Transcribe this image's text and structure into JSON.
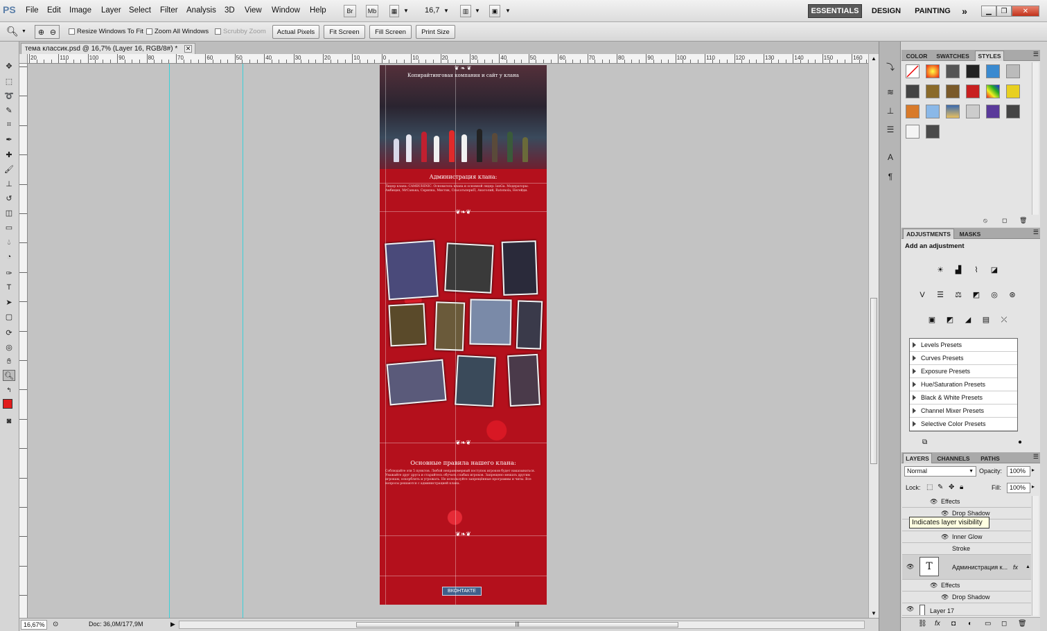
{
  "app": {
    "logo": "PS"
  },
  "menubar": {
    "items": [
      "File",
      "Edit",
      "Image",
      "Layer",
      "Select",
      "Filter",
      "Analysis",
      "3D",
      "View",
      "Window",
      "Help"
    ],
    "bridge_label": "Br",
    "minibridge_label": "Mb",
    "zoom_value": "16,7",
    "workspaces": {
      "essentials": "ESSENTIALS",
      "design": "DESIGN",
      "painting": "PAINTING",
      "more": "»"
    }
  },
  "options": {
    "resize_windows": "Resize Windows To Fit",
    "zoom_all": "Zoom All Windows",
    "scrubby": "Scrubby Zoom",
    "actual_pixels": "Actual Pixels",
    "fit_screen": "Fit Screen",
    "fill_screen": "Fill Screen",
    "print_size": "Print Size"
  },
  "document": {
    "tab_title": "тема классик.psd @ 16,7% (Layer 16, RGB/8#) *",
    "ruler_labels": [
      "20",
      "110",
      "100",
      "90",
      "80",
      "70",
      "60",
      "50",
      "40",
      "30",
      "20",
      "10",
      "0",
      "10",
      "20",
      "30",
      "40",
      "50",
      "60",
      "70",
      "80",
      "90",
      "100",
      "110",
      "120",
      "130",
      "140",
      "150",
      "160"
    ],
    "header_title": "Копирайтинговая компания и сайт у клана",
    "admin_title": "Администрация клана:",
    "admin_text": "Лидер клана: CAMBUHINIC. Основатель клана и основной лидер: lanGa. Модераторы: Амбиция, MrСанька, Скрипка, Мистик, СпасатьпериП, Анатолий, Ratomola, Негейди.",
    "rules_title": "Основные правила нашего клана:",
    "rules_text": "Соблюдайте эти 5 пунктов. Любой неправомерный поступок игроков будет наказываться. Уважайте друг друга и старайтесь обучать слабых игроков. Запрещено мешать другим игрокам, оскорблять и угрожать. Не используйте запрещённые программы и читы. Все вопросы решаются с администрацией клана.",
    "vk_button": "ВКОНТАКТЕ"
  },
  "status": {
    "zoom": "16,67%",
    "doc_size": "Doc: 36,0M/177,9M"
  },
  "panels": {
    "top_tabs": [
      "COLOR",
      "SWATCHES",
      "STYLES"
    ],
    "adj_tabs": [
      "ADJUSTMENTS",
      "MASKS"
    ],
    "add_adjustment": "Add an adjustment",
    "presets": [
      "Levels Presets",
      "Curves Presets",
      "Exposure Presets",
      "Hue/Saturation Presets",
      "Black & White Presets",
      "Channel Mixer Presets",
      "Selective Color Presets"
    ],
    "layers_tabs": [
      "LAYERS",
      "CHANNELS",
      "PATHS"
    ],
    "blend_mode": "Normal",
    "opacity_label": "Opacity:",
    "opacity_value": "100%",
    "lock_label": "Lock:",
    "fill_label": "Fill:",
    "fill_value": "100%",
    "layers": {
      "effects1": "Effects",
      "drop_shadow1": "Drop Shadow",
      "inner_glow": "Inner Glow",
      "stroke": "Stroke",
      "text_layer": "Администрация к...",
      "effects2": "Effects",
      "drop_shadow2": "Drop Shadow",
      "layer17": "Layer 17"
    },
    "tooltip": "Indicates layer visibility"
  },
  "colors": {
    "guide": "#3ad0d8",
    "page_red": "#a8101a",
    "foreground": "#e11b1b"
  }
}
